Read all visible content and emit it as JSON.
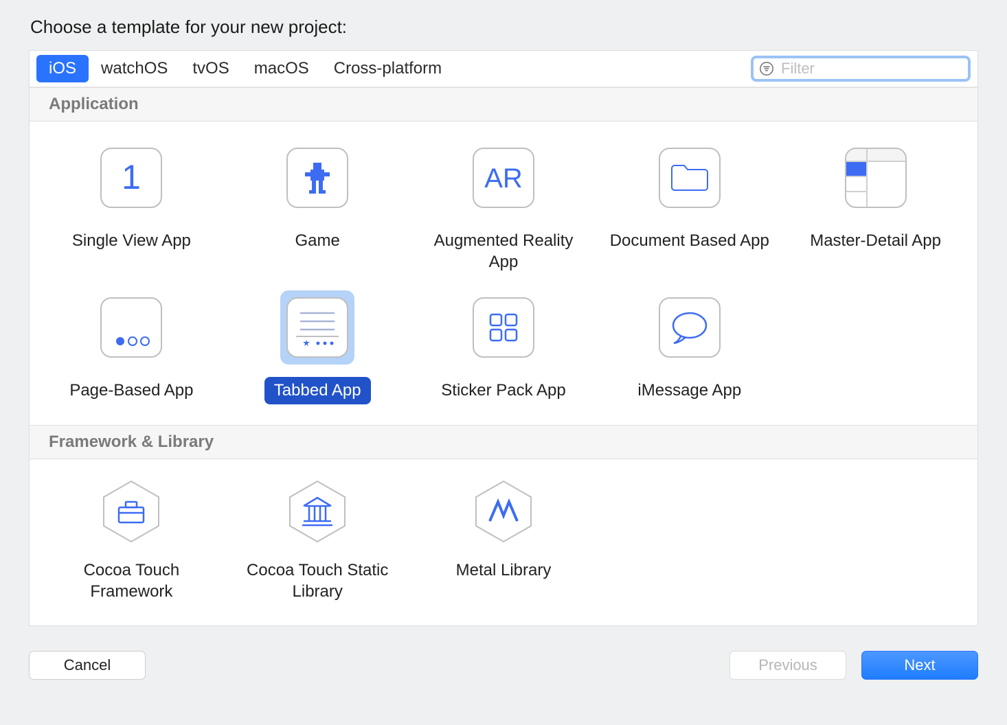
{
  "dialog": {
    "title": "Choose a template for your new project:",
    "tabs": [
      {
        "id": "ios",
        "label": "iOS",
        "active": true
      },
      {
        "id": "watchos",
        "label": "watchOS",
        "active": false
      },
      {
        "id": "tvos",
        "label": "tvOS",
        "active": false
      },
      {
        "id": "macos",
        "label": "macOS",
        "active": false
      },
      {
        "id": "cross",
        "label": "Cross-platform",
        "active": false
      }
    ],
    "filter": {
      "placeholder": "Filter",
      "value": ""
    }
  },
  "sections": [
    {
      "id": "application",
      "title": "Application",
      "templates": [
        {
          "id": "single-view",
          "label": "Single View App",
          "icon": "one-icon",
          "selected": false
        },
        {
          "id": "game",
          "label": "Game",
          "icon": "game-icon",
          "selected": false
        },
        {
          "id": "ar",
          "label": "Augmented Reality App",
          "icon": "ar-icon",
          "selected": false
        },
        {
          "id": "document",
          "label": "Document Based App",
          "icon": "folder-icon",
          "selected": false
        },
        {
          "id": "master-detail",
          "label": "Master-Detail App",
          "icon": "master-detail-icon",
          "selected": false
        },
        {
          "id": "page-based",
          "label": "Page-Based App",
          "icon": "page-dots-icon",
          "selected": false
        },
        {
          "id": "tabbed",
          "label": "Tabbed App",
          "icon": "tabbed-icon",
          "selected": true
        },
        {
          "id": "sticker",
          "label": "Sticker Pack App",
          "icon": "grid-icon",
          "selected": false
        },
        {
          "id": "imessage",
          "label": "iMessage App",
          "icon": "chat-bubble-icon",
          "selected": false
        }
      ]
    },
    {
      "id": "framework",
      "title": "Framework & Library",
      "templates": [
        {
          "id": "cocoa-framework",
          "label": "Cocoa Touch Framework",
          "icon": "toolbox-hex-icon",
          "selected": false
        },
        {
          "id": "cocoa-static",
          "label": "Cocoa Touch Static Library",
          "icon": "building-hex-icon",
          "selected": false
        },
        {
          "id": "metal",
          "label": "Metal Library",
          "icon": "metal-hex-icon",
          "selected": false
        }
      ]
    }
  ],
  "footer": {
    "cancel": "Cancel",
    "previous": "Previous",
    "next": "Next"
  },
  "colors": {
    "accent": "#2a73ff",
    "icon-blue": "#3d6cf3"
  }
}
